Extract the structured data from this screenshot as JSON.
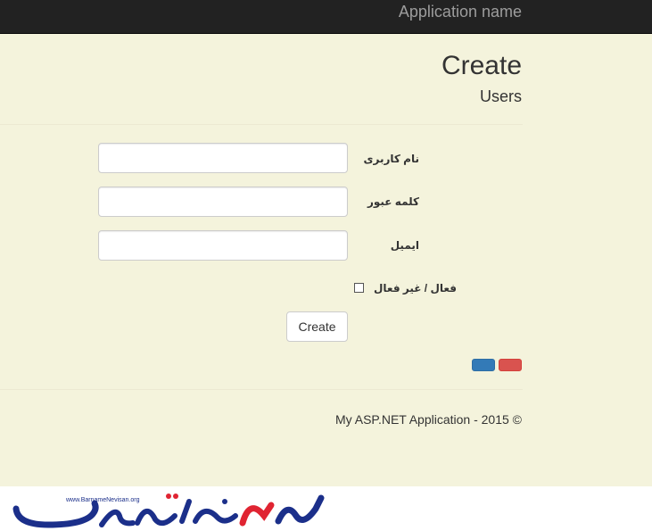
{
  "navbar": {
    "brand": "Application name"
  },
  "page": {
    "title": "Create",
    "subtitle": "Users"
  },
  "form": {
    "username_label": "نام کاربری",
    "username_value": "",
    "password_label": "کلمه عبور",
    "password_value": "",
    "email_label": "ایمیل",
    "email_value": "",
    "active_label": "فعال / غیر فعال",
    "active_checked": false,
    "submit_label": "Create"
  },
  "toolbar": {
    "buttons": [
      {
        "color": "#337ab7",
        "icon": "blue-button"
      },
      {
        "color": "#d9534f",
        "icon": "red-button"
      }
    ]
  },
  "footer": {
    "text": "My ASP.NET Application - 2015 ©"
  },
  "watermark": {
    "url_text": "www.BarnameNevisan.org",
    "logo_text": "برنامه نویسان",
    "colors": {
      "primary": "#1b2f8a",
      "accent": "#e02432"
    }
  },
  "colors": {
    "navbar_bg": "#222222",
    "main_bg": "#f4f3dc"
  }
}
